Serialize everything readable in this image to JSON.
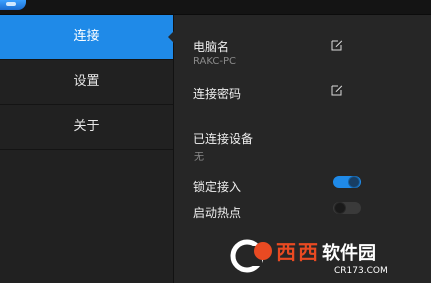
{
  "sidebar": {
    "items": [
      {
        "label": "连接",
        "active": true
      },
      {
        "label": "设置",
        "active": false
      },
      {
        "label": "关于",
        "active": false
      }
    ]
  },
  "content": {
    "pc_name_label": "电脑名",
    "pc_name_value": "RAKC-PC",
    "password_label": "连接密码",
    "connected_devices_label": "已连接设备",
    "connected_devices_value": "无",
    "lock_access_label": "锁定接入",
    "lock_access_on": true,
    "hotspot_label": "启动热点",
    "hotspot_on": false
  },
  "watermark": {
    "brand": "西西软件园",
    "url": "CR173.COM"
  },
  "colors": {
    "accent": "#1f8ae8",
    "bg_sidebar": "#212121",
    "bg_content": "#262626"
  },
  "icons": [
    "app-logo-icon",
    "edit-icon",
    "toggle-switch"
  ]
}
